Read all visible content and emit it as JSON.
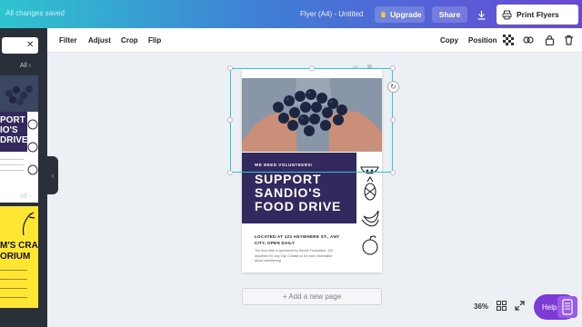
{
  "header": {
    "saved_status": "All changes saved",
    "doc_title": "Flyer (A4) - Untitled",
    "upgrade_label": "Upgrade",
    "share_label": "Share",
    "print_label": "Print Flyers",
    "icons": {
      "upgrade": "crown-icon",
      "download": "download-icon",
      "print": "printer-icon"
    }
  },
  "left_panel": {
    "see_all_1": "All",
    "see_all_2": "All",
    "thumb1_text": "PORT\nIO'S\nDRIVE",
    "thumb2_text": "M'S CRAB\nORIUM"
  },
  "toolbar": {
    "filter": "Filter",
    "adjust": "Adjust",
    "crop": "Crop",
    "flip": "Flip",
    "copy": "Copy",
    "position": "Position"
  },
  "flyer": {
    "volunteer_line": "WE NEED VOLUNTEERS!",
    "headline": "SUPPORT SANDIO'S FOOD DRIVE",
    "address": "LOCATED AT 123 ANYWHERE ST., ANY CITY, OPEN DAILY",
    "small_text": "The food drive is sponsored by Sandio Foundation, 123 Anywhere St. Any City. Contact us for more information about volunteering."
  },
  "canvas": {
    "add_page_label": "+ Add a new page",
    "zoom_level": "36%"
  },
  "help": {
    "label": "Help"
  },
  "colors": {
    "brand_gradient_start": "#2ec5cf",
    "brand_gradient_end": "#6a47d6",
    "flyer_purple": "#34295e",
    "selection": "#2ec5cf",
    "help": "#7d3bd6"
  }
}
